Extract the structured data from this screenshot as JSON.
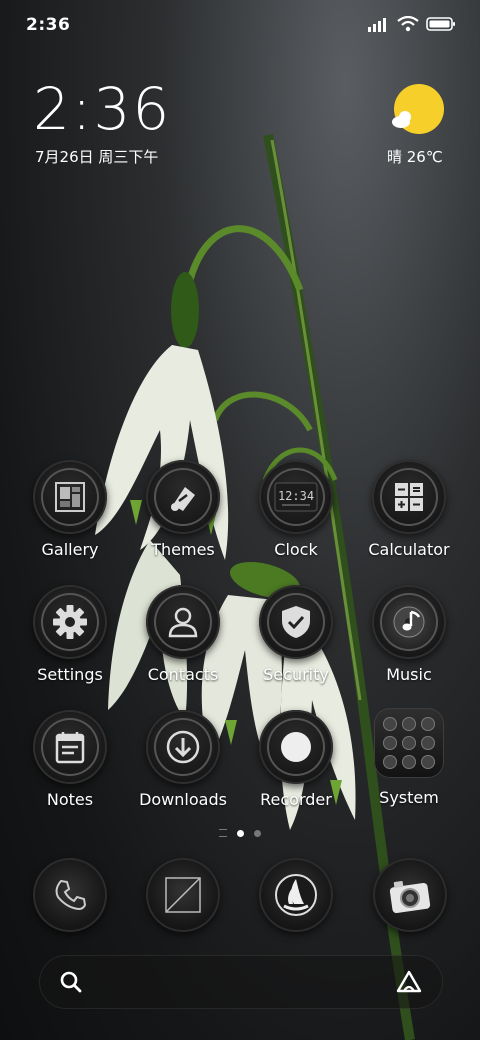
{
  "status_bar": {
    "time": "2:36"
  },
  "clock_widget": {
    "time": "2:36",
    "date": "7月26日 周三下午"
  },
  "weather": {
    "text": "晴 26℃",
    "icon": "sunny-cloud-icon",
    "sun_color": "#f6cf2a"
  },
  "apps": [
    {
      "label": "Gallery",
      "icon": "gallery-icon"
    },
    {
      "label": "Themes",
      "icon": "themes-icon"
    },
    {
      "label": "Clock",
      "icon": "clock-icon",
      "face_text": "12:34"
    },
    {
      "label": "Calculator",
      "icon": "calculator-icon"
    },
    {
      "label": "Settings",
      "icon": "gear-icon"
    },
    {
      "label": "Contacts",
      "icon": "contacts-icon"
    },
    {
      "label": "Security",
      "icon": "shield-icon"
    },
    {
      "label": "Music",
      "icon": "music-icon"
    },
    {
      "label": "Notes",
      "icon": "notes-icon"
    },
    {
      "label": "Downloads",
      "icon": "download-icon"
    },
    {
      "label": "Recorder",
      "icon": "recorder-icon"
    },
    {
      "label": "System",
      "icon": "system-folder-icon"
    }
  ],
  "page_indicator": {
    "pages": 2,
    "current": 1
  },
  "dock": [
    {
      "icon": "phone-icon"
    },
    {
      "icon": "messages-icon"
    },
    {
      "icon": "browser-sail-icon"
    },
    {
      "icon": "camera-icon"
    }
  ],
  "search_bar": {
    "left_icon": "search-icon",
    "right_icon": "assistant-icon"
  }
}
